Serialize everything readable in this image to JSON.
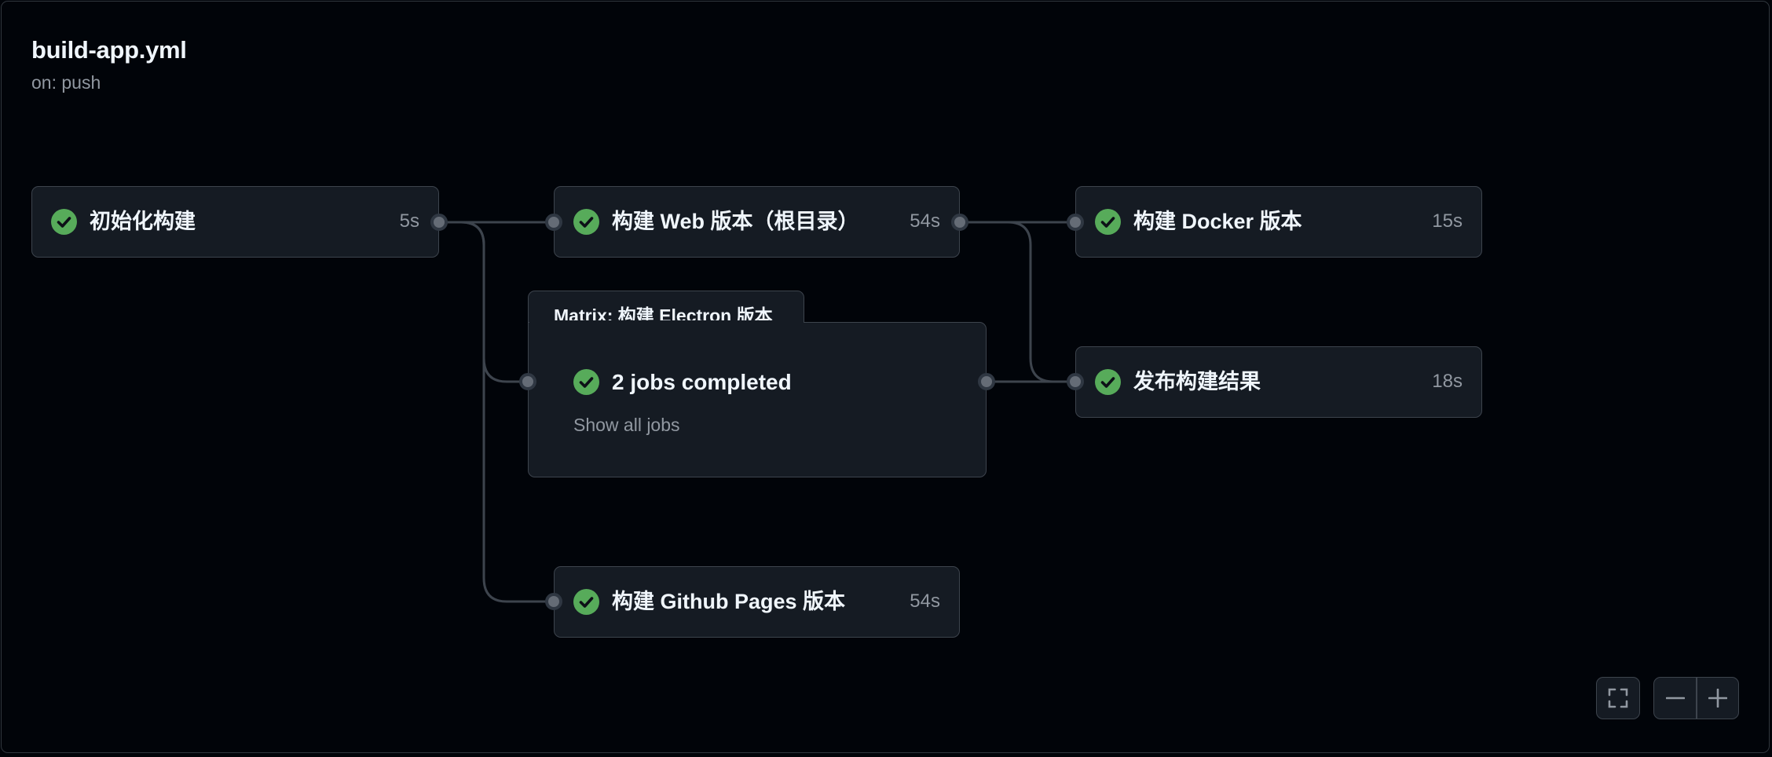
{
  "workflow": {
    "title": "build-app.yml",
    "trigger": "on: push"
  },
  "jobs": {
    "init": {
      "name": "初始化构建",
      "duration": "5s",
      "status": "success"
    },
    "web": {
      "name": "构建 Web 版本（根目录）",
      "duration": "54s",
      "status": "success"
    },
    "docker": {
      "name": "构建 Docker 版本",
      "duration": "15s",
      "status": "success"
    },
    "publish": {
      "name": "发布构建结果",
      "duration": "18s",
      "status": "success"
    },
    "pages": {
      "name": "构建 Github Pages 版本",
      "duration": "54s",
      "status": "success"
    }
  },
  "matrix": {
    "label": "Matrix: 构建 Electron 版本",
    "summary": "2 jobs completed",
    "show_all": "Show all jobs",
    "status": "success"
  },
  "controls": {
    "fullscreen_icon": "fullscreen-icon",
    "zoom_out_icon": "minus-icon",
    "zoom_in_icon": "plus-icon"
  },
  "colors": {
    "success": "#57ab5a",
    "background": "#010409",
    "card": "#151b23",
    "border": "#3d444d",
    "text_primary": "#f0f6fc",
    "text_muted": "#9198a1"
  }
}
